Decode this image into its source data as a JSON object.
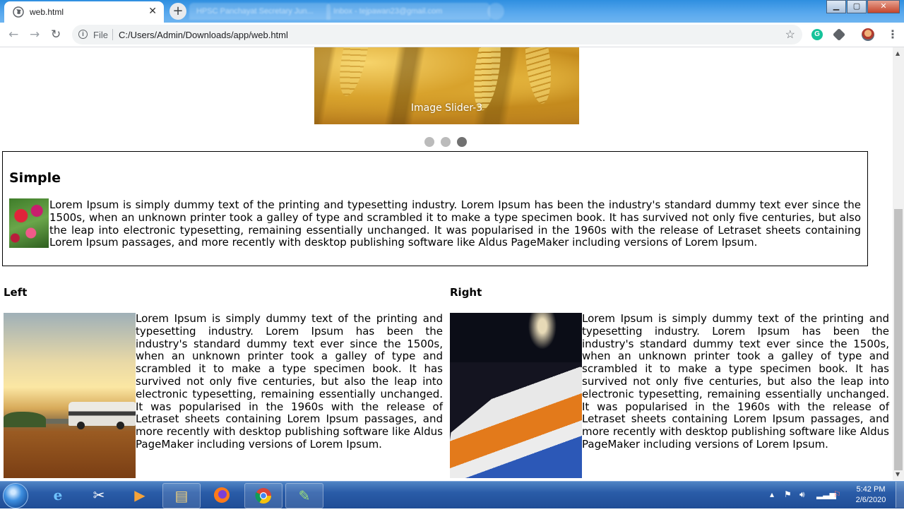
{
  "browser": {
    "tabs": [
      {
        "title": "web.html",
        "active": true
      },
      {
        "title": "HPSC Panchayat Secretary Jun...",
        "active": false
      },
      {
        "title": "Inbox - tejpawan23@gmail.com",
        "active": false
      }
    ],
    "address_scheme": "File",
    "address_url": "C:/Users/Admin/Downloads/app/web.html",
    "icons": [
      "back-icon",
      "forward-icon",
      "reload-icon",
      "info-icon",
      "star-icon",
      "grammarly-icon",
      "extension-icon",
      "profile-avatar",
      "menu-icon"
    ]
  },
  "page": {
    "slider": {
      "caption": "Image Slider-3",
      "total_slides": 3,
      "active_slide": 3
    },
    "simple": {
      "heading": "Simple",
      "text": "Lorem Ipsum is simply dummy text of the printing and typesetting industry. Lorem Ipsum has been the industry's standard dummy text ever since the 1500s, when an unknown printer took a galley of type and scrambled it to make a type specimen book. It has survived not only five centuries, but also the leap into electronic typesetting, remaining essentially unchanged. It was popularised in the 1960s with the release of Letraset sheets containing Lorem Ipsum passages, and more recently with desktop publishing software like Aldus PageMaker including versions of Lorem Ipsum."
    },
    "left": {
      "heading": "Left",
      "text": "Lorem Ipsum is simply dummy text of the printing and typesetting industry. Lorem Ipsum has been the industry's standard dummy text ever since the 1500s, when an unknown printer took a galley of type and scrambled it to make a type specimen book. It has survived not only five centuries, but also the leap into electronic typesetting, remaining essentially unchanged. It was popularised in the 1960s with the release of Letraset sheets containing Lorem Ipsum passages, and more recently with desktop publishing software like Aldus PageMaker including versions of Lorem Ipsum."
    },
    "right": {
      "heading": "Right",
      "text": "Lorem Ipsum is simply dummy text of the printing and typesetting industry. Lorem Ipsum has been the industry's standard dummy text ever since the 1500s, when an unknown printer took a galley of type and scrambled it to make a type specimen book. It has survived not only five centuries, but also the leap into electronic typesetting, remaining essentially unchanged. It was popularised in the 1960s with the release of Letraset sheets containing Lorem Ipsum passages, and more recently with desktop publishing software like Aldus PageMaker including versions of Lorem Ipsum."
    }
  },
  "taskbar": {
    "apps": [
      "internet-explorer-icon",
      "snipping-tool-icon",
      "media-player-icon",
      "file-explorer-icon",
      "firefox-icon",
      "chrome-icon",
      "paint-icon"
    ],
    "clock_time": "5:42 PM",
    "clock_date": "2/6/2020"
  },
  "colors": {
    "tab_strip": "#2f8fe0",
    "dot_inactive": "#bbbbbb",
    "dot_active": "#717171",
    "taskbar": "#2a5ca8"
  }
}
